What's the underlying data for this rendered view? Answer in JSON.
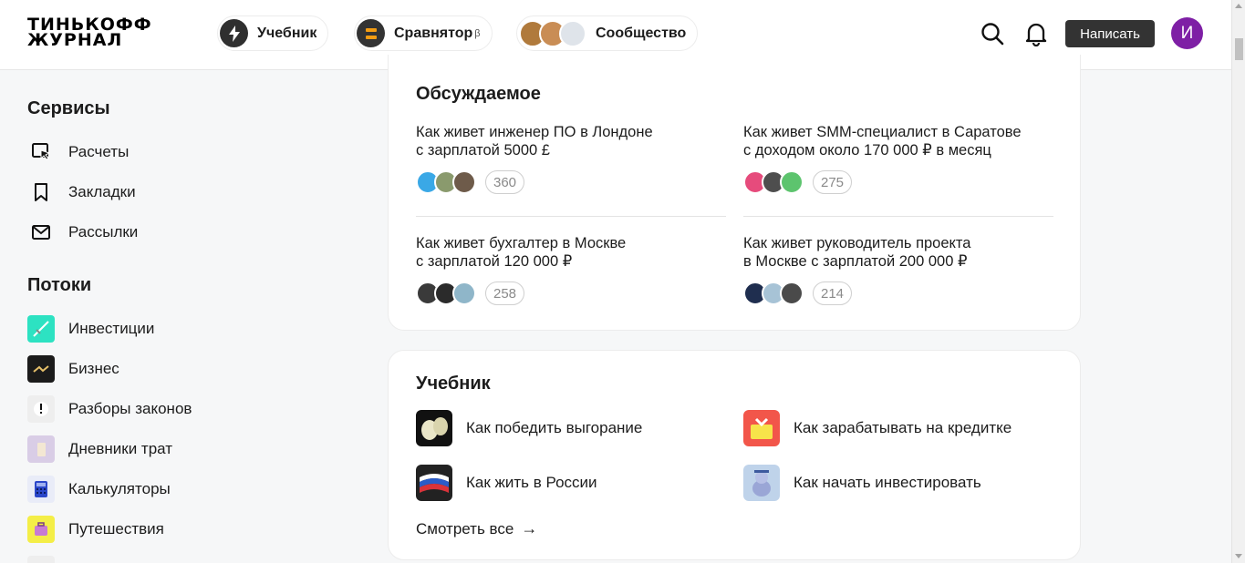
{
  "header": {
    "logo_line1": "ТИНЬКОФФ",
    "logo_line2": "ЖУРНАЛ",
    "nav": [
      {
        "label": "Учебник",
        "icon": "bolt-icon"
      },
      {
        "label": "Сравнятор",
        "sup": "β",
        "icon": "compare-icon"
      },
      {
        "label": "Сообщество",
        "icon": "community-avatars"
      }
    ],
    "write_label": "Написать",
    "user_initial": "И"
  },
  "sidebar": {
    "services_title": "Сервисы",
    "services": [
      {
        "label": "Расчеты",
        "icon": "cursor-window-icon"
      },
      {
        "label": "Закладки",
        "icon": "bookmark-icon"
      },
      {
        "label": "Рассылки",
        "icon": "mail-icon"
      }
    ],
    "streams_title": "Потоки",
    "streams": [
      {
        "label": "Инвестиции",
        "icon": "investments-icon",
        "color": "#2de2c2"
      },
      {
        "label": "Бизнес",
        "icon": "business-icon",
        "color": "#1b1b1b"
      },
      {
        "label": "Разборы законов",
        "icon": "law-icon",
        "color": "#eeeeee"
      },
      {
        "label": "Дневники трат",
        "icon": "diary-icon",
        "color": "#d9cde6"
      },
      {
        "label": "Калькуляторы",
        "icon": "calculator-icon",
        "color": "#2b47c9"
      },
      {
        "label": "Путешествия",
        "icon": "travel-icon",
        "color": "#f4ee47"
      }
    ]
  },
  "discussed": {
    "title": "Обсуждаемое",
    "items": [
      {
        "line1": "Как живет инженер ПО в Лондоне",
        "line2": "с зарплатой 5000 £",
        "comments": "360"
      },
      {
        "line1": "Как живет SMM-специалист в Саратове",
        "line2": "с доходом около 170 000 ₽ в месяц",
        "comments": "275"
      },
      {
        "line1": "Как живет бухгалтер в Москве",
        "line2": "с зарплатой 120 000 ₽",
        "comments": "258"
      },
      {
        "line1": "Как живет руководитель проекта",
        "line2": "в Москве с зарплатой 200 000 ₽",
        "comments": "214"
      }
    ]
  },
  "textbook": {
    "title": "Учебник",
    "courses": [
      {
        "label": "Как победить выгорание",
        "icon": "burnout-icon"
      },
      {
        "label": "Как зарабатывать на кредитке",
        "icon": "credit-card-icon"
      },
      {
        "label": "Как жить в России",
        "icon": "russia-flag-icon"
      },
      {
        "label": "Как начать инвестировать",
        "icon": "invest-start-icon"
      }
    ],
    "see_all": "Смотреть все",
    "see_all_arrow": "→"
  },
  "colors": {
    "accent_dark": "#333333",
    "user_avatar": "#7e1fa5",
    "background": "#f6f7f8"
  }
}
